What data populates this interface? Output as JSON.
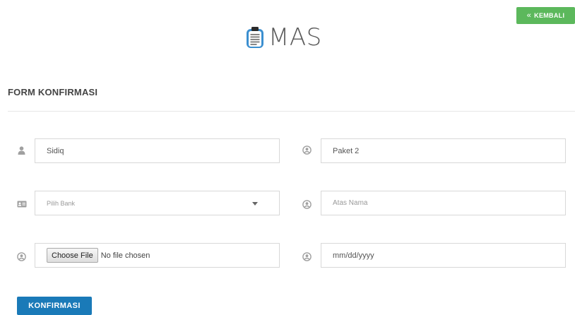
{
  "header": {
    "back_button_label": "KEMBALI",
    "logo_text": "MAS"
  },
  "form": {
    "title": "FORM KONFIRMASI",
    "name_value": "Sidiq",
    "package_value": "Paket 2",
    "bank_select_value": "Pilih Bank",
    "account_name_placeholder": "Atas Nama",
    "file_button_label": "Choose File",
    "file_status": "No file chosen",
    "date_placeholder": "mm/dd/yyyy",
    "submit_label": "KONFIRMASI"
  },
  "colors": {
    "back_button": "#5cb85c",
    "submit_button": "#1a7ab8",
    "logo_icon": "#3b8fd0"
  },
  "icons": [
    "double-chevron-left-icon",
    "clipboard-icon",
    "user-icon",
    "user-circle-icon",
    "id-card-icon",
    "caret-down-icon"
  ]
}
